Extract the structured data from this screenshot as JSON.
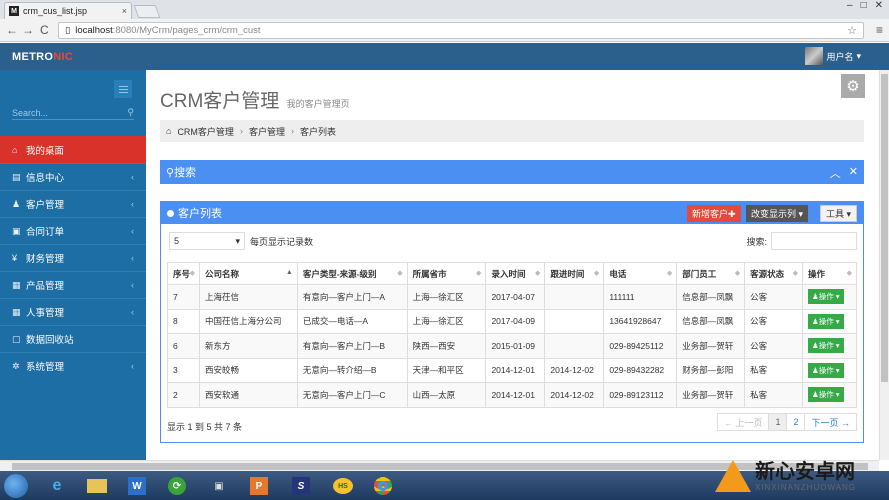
{
  "browser": {
    "tab_title": "crm_cus_list.jsp",
    "tab_close": "×",
    "win_buttons": [
      "–",
      "□",
      "✕"
    ],
    "url_host": "localhost",
    "url_path": ":8080/MyCrm/pages_crm/crm_cust",
    "back": "←",
    "forward": "→",
    "reload": "C",
    "star": "☆",
    "menu": "≡"
  },
  "header": {
    "logo_main": "METRO",
    "logo_accent": "NIC",
    "user_name": "用户名",
    "user_caret": "▾"
  },
  "sidebar": {
    "search_placeholder": "Search...",
    "items": [
      {
        "label": "我的桌面",
        "icon": "home-icon",
        "glyph": "⌂"
      },
      {
        "label": "信息中心",
        "icon": "info-icon",
        "glyph": "▤"
      },
      {
        "label": "客户管理",
        "icon": "user-icon",
        "glyph": "♟"
      },
      {
        "label": "合同订单",
        "icon": "doc-icon",
        "glyph": "▣"
      },
      {
        "label": "财务管理",
        "icon": "yen-icon",
        "glyph": "¥"
      },
      {
        "label": "产品管理",
        "icon": "grid-icon",
        "glyph": "▦"
      },
      {
        "label": "人事管理",
        "icon": "table-icon",
        "glyph": "▦"
      },
      {
        "label": "数据回收站",
        "icon": "trash-icon",
        "glyph": "▢"
      },
      {
        "label": "系统管理",
        "icon": "gear-icon",
        "glyph": "✲"
      }
    ],
    "arrow": "‹"
  },
  "main": {
    "title": "CRM客户管理",
    "subtitle": "我的客户管理页",
    "breadcrumb": [
      "CRM客户管理",
      "客户管理",
      "客户列表"
    ],
    "search_panel_title": "搜索",
    "list_panel_title": "客户列表",
    "btn_new": "新增客户✚",
    "btn_view": "改变显示列 ▾",
    "btn_tools": "工具 ▾",
    "page_len_value": "5",
    "page_len_label": "每页显示记录数",
    "search_label": "搜索:",
    "columns": [
      "序号",
      "公司名称",
      "客户类型-来源-级别",
      "所属省市",
      "录入时间",
      "跟进时间",
      "电话",
      "部门员工",
      "客源状态",
      "操作"
    ],
    "rows": [
      [
        "7",
        "上海茌信",
        "有意向—客户上门—A",
        "上海—徐汇区",
        "2017-04-07",
        "",
        "111111",
        "信息部—凤飘",
        "公客"
      ],
      [
        "8",
        "中国茌信上海分公司",
        "已成交—电话—A",
        "上海—徐汇区",
        "2017-04-09",
        "",
        "13641928647",
        "信息部—凤飘",
        "公客"
      ],
      [
        "6",
        "新东方",
        "有意向—客户上门—B",
        "陕西—西安",
        "2015-01-09",
        "",
        "029-89425112",
        "业务部—贺轩",
        "公客"
      ],
      [
        "3",
        "西安皎畅",
        "无意向—转介绍—B",
        "天津—和平区",
        "2014-12-01",
        "2014-12-02",
        "029-89432282",
        "财务部—彭阳",
        "私客"
      ],
      [
        "2",
        "西安软通",
        "无意向—客户上门—C",
        "山西—太原",
        "2014-12-01",
        "2014-12-02",
        "029-89123112",
        "业务部—贺轩",
        "私客"
      ]
    ],
    "op_label": "♟操作 ▾",
    "info": "显示 1 到 5 共 7 条",
    "pager": [
      "← 上一页",
      "1",
      "2",
      "下一页 →"
    ]
  },
  "watermark": {
    "cn": "新心安卓网",
    "en": "XINXINANZHUOWANG"
  },
  "colors": {
    "header": "#2b5f8c",
    "sidebar": "#1c6ea4",
    "active": "#d9322a",
    "panel": "#4c8ff2"
  }
}
